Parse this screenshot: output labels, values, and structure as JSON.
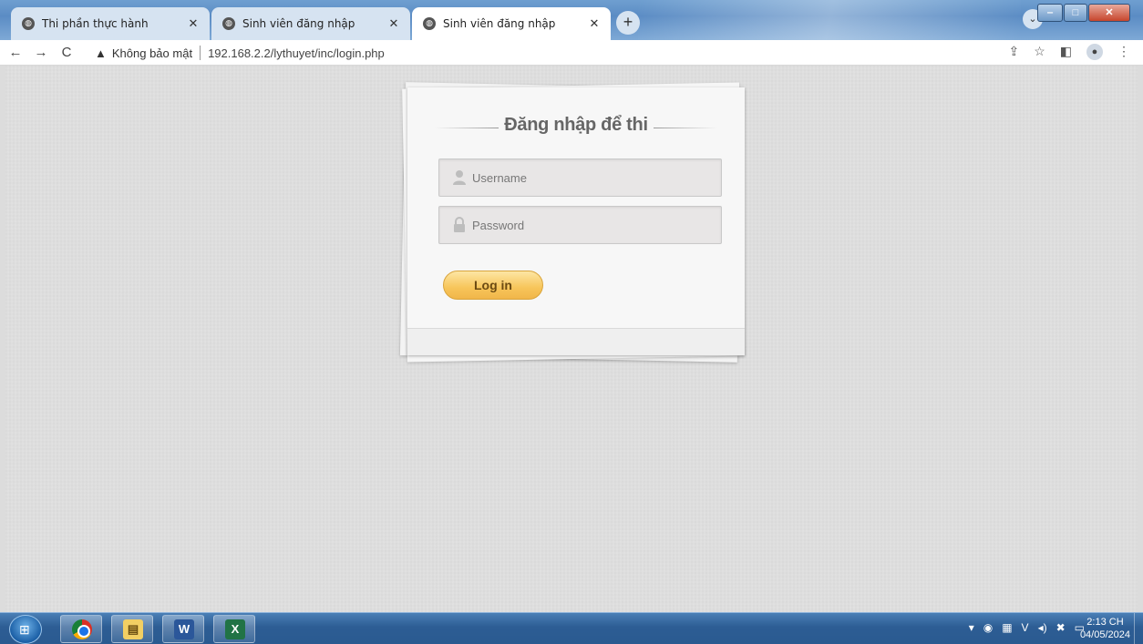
{
  "browser": {
    "tabs": [
      {
        "label": "Thi phần thực hành",
        "active": false
      },
      {
        "label": "Sinh viên đăng nhập",
        "active": false
      },
      {
        "label": "Sinh viên đăng nhập",
        "active": true
      }
    ],
    "new_tab": "+",
    "security_label": "Không bảo mật",
    "url": "192.168.2.2/lythuyet/inc/login.php"
  },
  "login": {
    "heading": "Đăng nhập để thi",
    "username_placeholder": "Username",
    "password_placeholder": "Password",
    "login_button": "Log in"
  },
  "taskbar": {
    "apps": [
      "chrome",
      "file-explorer",
      "word",
      "excel"
    ],
    "clock_time": "2:13 CH",
    "clock_date": "04/05/2024"
  },
  "colors": {
    "login_button": "#f7c55a",
    "page_background": "#dedede",
    "taskbar": "#2d5d94"
  }
}
